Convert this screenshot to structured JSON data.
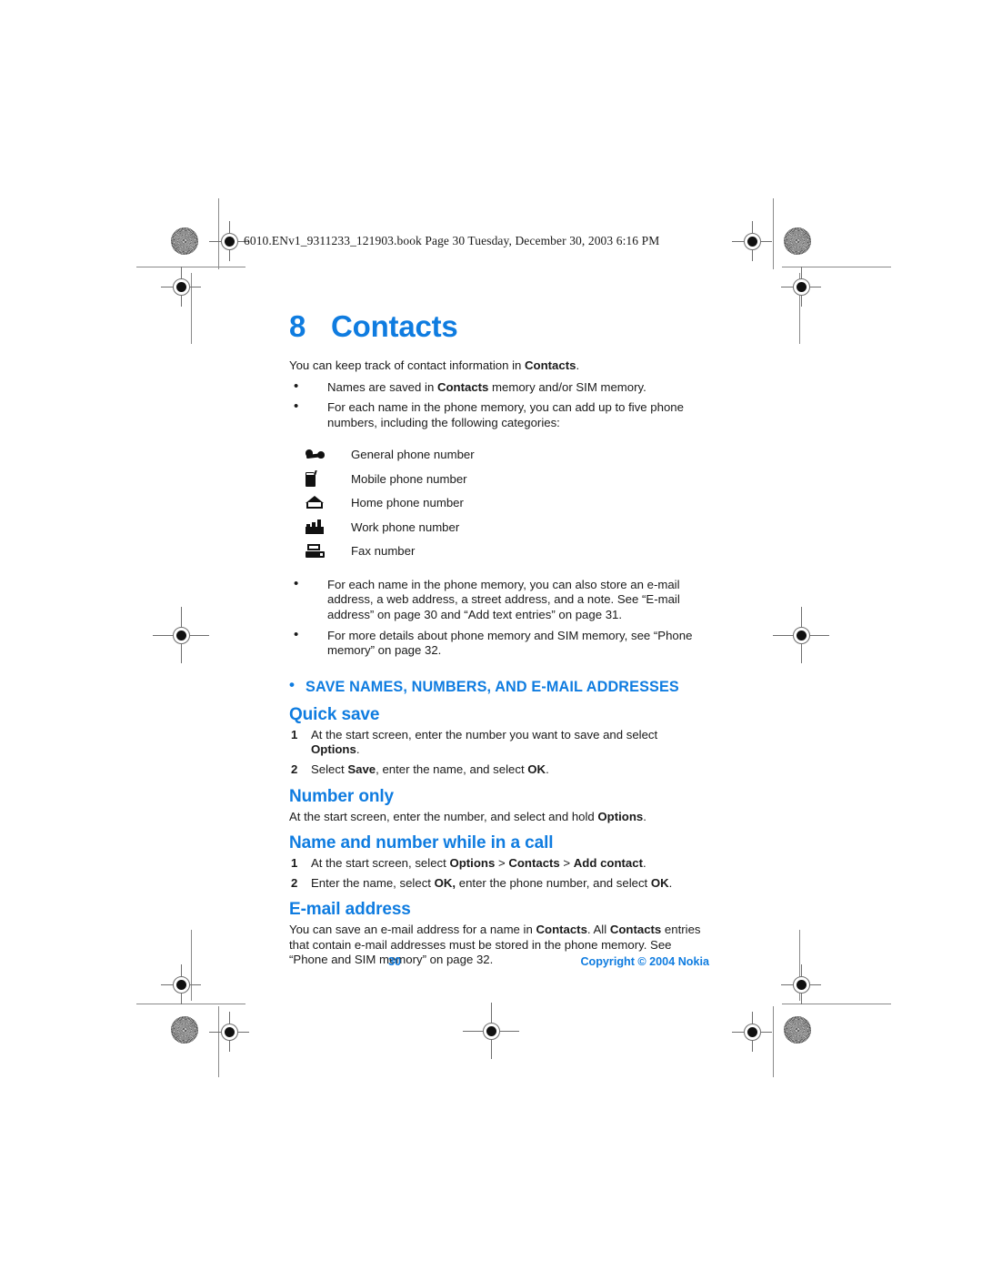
{
  "print_slug": "6010.ENv1_9311233_121903.book  Page 30  Tuesday, December 30, 2003  6:16 PM",
  "colors": {
    "heading_blue": "#0f7ce0",
    "body_text": "#1a1a1a",
    "mark_gray": "#6e6e6e"
  },
  "chapter": {
    "number": "8",
    "title": "Contacts"
  },
  "intro": {
    "lead_1": "You can keep track of contact information in ",
    "lead_bold": "Contacts",
    "lead_2": "."
  },
  "bullets_top": [
    {
      "parts": [
        {
          "text": "Names are saved in ",
          "bold": false
        },
        {
          "text": "Contacts",
          "bold": true
        },
        {
          "text": " memory and/or SIM memory.",
          "bold": false
        }
      ]
    },
    {
      "parts": [
        {
          "text": "For each name in the phone memory, you can add up to five phone numbers, including the following categories:",
          "bold": false
        }
      ]
    }
  ],
  "categories": [
    {
      "icon": "telephone-icon",
      "label": "General phone number"
    },
    {
      "icon": "mobile-phone-icon",
      "label": "Mobile phone number"
    },
    {
      "icon": "home-icon",
      "label": "Home phone number"
    },
    {
      "icon": "work-factory-icon",
      "label": "Work phone number"
    },
    {
      "icon": "fax-icon",
      "label": "Fax number"
    }
  ],
  "bullets_bottom": [
    {
      "parts": [
        {
          "text": "For each name in the phone memory, you can also store an e-mail address, a web address, a street address, and a note. See “E-mail address” on page 30 and “Add text entries” on page 31.",
          "bold": false
        }
      ]
    },
    {
      "parts": [
        {
          "text": "For more details about phone memory and SIM memory, see “Phone memory” on page 32.",
          "bold": false
        }
      ]
    }
  ],
  "section": {
    "heading": "SAVE NAMES, NUMBERS, AND E-MAIL ADDRESSES"
  },
  "quick_save": {
    "heading": "Quick save",
    "steps": [
      {
        "num": "1",
        "parts": [
          {
            "text": "At the start screen, enter the number you want to save and select ",
            "bold": false
          },
          {
            "text": "Options",
            "bold": true
          },
          {
            "text": ".",
            "bold": false
          }
        ]
      },
      {
        "num": "2",
        "parts": [
          {
            "text": "Select ",
            "bold": false
          },
          {
            "text": "Save",
            "bold": true
          },
          {
            "text": ", enter the name, and select ",
            "bold": false
          },
          {
            "text": "OK",
            "bold": true
          },
          {
            "text": ".",
            "bold": false
          }
        ]
      }
    ]
  },
  "number_only": {
    "heading": "Number only",
    "body_parts": [
      {
        "text": "At the start screen, enter the number, and select and hold ",
        "bold": false
      },
      {
        "text": "Options",
        "bold": true
      },
      {
        "text": ".",
        "bold": false
      }
    ]
  },
  "name_number_call": {
    "heading": "Name and number while in a call",
    "steps": [
      {
        "num": "1",
        "parts": [
          {
            "text": "At the start screen, select ",
            "bold": false
          },
          {
            "text": "Options",
            "bold": true
          },
          {
            "text": " > ",
            "bold": false
          },
          {
            "text": "Contacts",
            "bold": true
          },
          {
            "text": " > ",
            "bold": false
          },
          {
            "text": "Add contact",
            "bold": true
          },
          {
            "text": ".",
            "bold": false
          }
        ]
      },
      {
        "num": "2",
        "parts": [
          {
            "text": "Enter the name, select ",
            "bold": false
          },
          {
            "text": "OK,",
            "bold": true
          },
          {
            "text": " enter the phone number, and select ",
            "bold": false
          },
          {
            "text": "OK",
            "bold": true
          },
          {
            "text": ".",
            "bold": false
          }
        ]
      }
    ]
  },
  "email_address": {
    "heading": "E-mail address",
    "body_parts": [
      {
        "text": "You can save an e-mail address for a name in ",
        "bold": false
      },
      {
        "text": "Contacts",
        "bold": true
      },
      {
        "text": ". All ",
        "bold": false
      },
      {
        "text": "Contacts",
        "bold": true
      },
      {
        "text": " entries that contain e-mail addresses must be stored in the phone memory. See “Phone and SIM memory” on page 32.",
        "bold": false
      }
    ]
  },
  "footer": {
    "page_number": "30",
    "copyright": "Copyright © 2004 Nokia"
  }
}
